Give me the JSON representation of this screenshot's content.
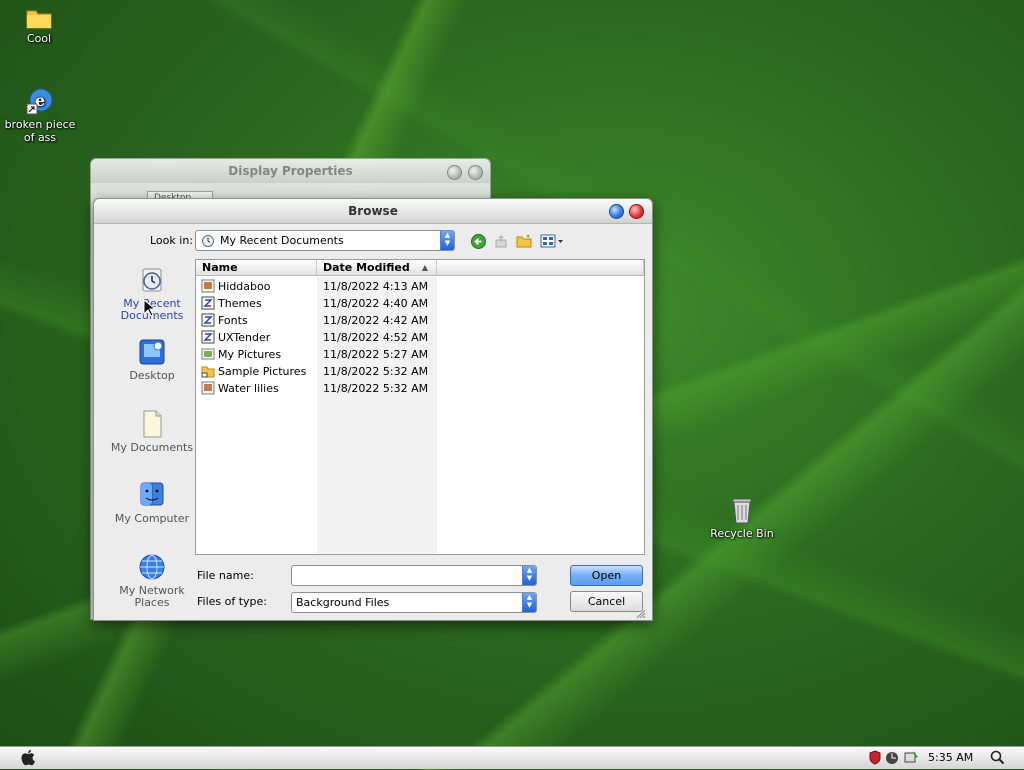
{
  "desktop": {
    "icons": [
      {
        "label": "Cool",
        "icon": "folder-icon"
      },
      {
        "label": "broken piece of ass",
        "icon": "internet-explorer-shortcut-icon"
      },
      {
        "label": "Recycle Bin",
        "icon": "recycle-bin-icon"
      }
    ]
  },
  "background_window": {
    "title": "Display Properties",
    "tab_label": "Desktop"
  },
  "dialog": {
    "title": "Browse",
    "look_in_label": "Look in:",
    "look_in_value": "My Recent Documents",
    "places": [
      {
        "label": "My Recent Documents",
        "icon": "recent-documents-icon"
      },
      {
        "label": "Desktop",
        "icon": "desktop-icon"
      },
      {
        "label": "My Documents",
        "icon": "my-documents-icon"
      },
      {
        "label": "My Computer",
        "icon": "my-computer-icon"
      },
      {
        "label": "My Network Places",
        "icon": "network-places-icon"
      }
    ],
    "columns": {
      "name": "Name",
      "modified": "Date Modified"
    },
    "files": [
      {
        "name": "Hiddaboo",
        "modified": "11/8/2022 4:13 AM"
      },
      {
        "name": "Themes",
        "modified": "11/8/2022 4:40 AM"
      },
      {
        "name": "Fonts",
        "modified": "11/8/2022 4:42 AM"
      },
      {
        "name": "UXTender",
        "modified": "11/8/2022 4:52 AM"
      },
      {
        "name": "My Pictures",
        "modified": "11/8/2022 5:27 AM"
      },
      {
        "name": "Sample Pictures",
        "modified": "11/8/2022 5:32 AM"
      },
      {
        "name": "Water lilies",
        "modified": "11/8/2022 5:32 AM"
      }
    ],
    "file_name_label": "File name:",
    "file_name_value": "",
    "files_of_type_label": "Files of type:",
    "files_of_type_value": "Background Files",
    "open_label": "Open",
    "cancel_label": "Cancel"
  },
  "taskbar": {
    "clock": "5:35 AM"
  },
  "colors": {
    "accent": "#5b9cf0",
    "close": "#e43a3a",
    "help": "#3a7dde"
  }
}
